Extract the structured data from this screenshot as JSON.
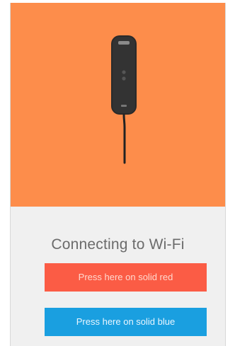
{
  "screen": {
    "status_title": "Connecting to Wi-Fi",
    "buttons": {
      "red_label": "Press here on solid red",
      "blue_label": "Press here on solid blue"
    },
    "colors": {
      "hero_background": "#fd8d4b",
      "red_button": "#fb5c45",
      "blue_button": "#1a9fe0",
      "panel_background": "#f0f0f0"
    },
    "illustration": {
      "icon": "wifi-hub-device-icon"
    }
  }
}
